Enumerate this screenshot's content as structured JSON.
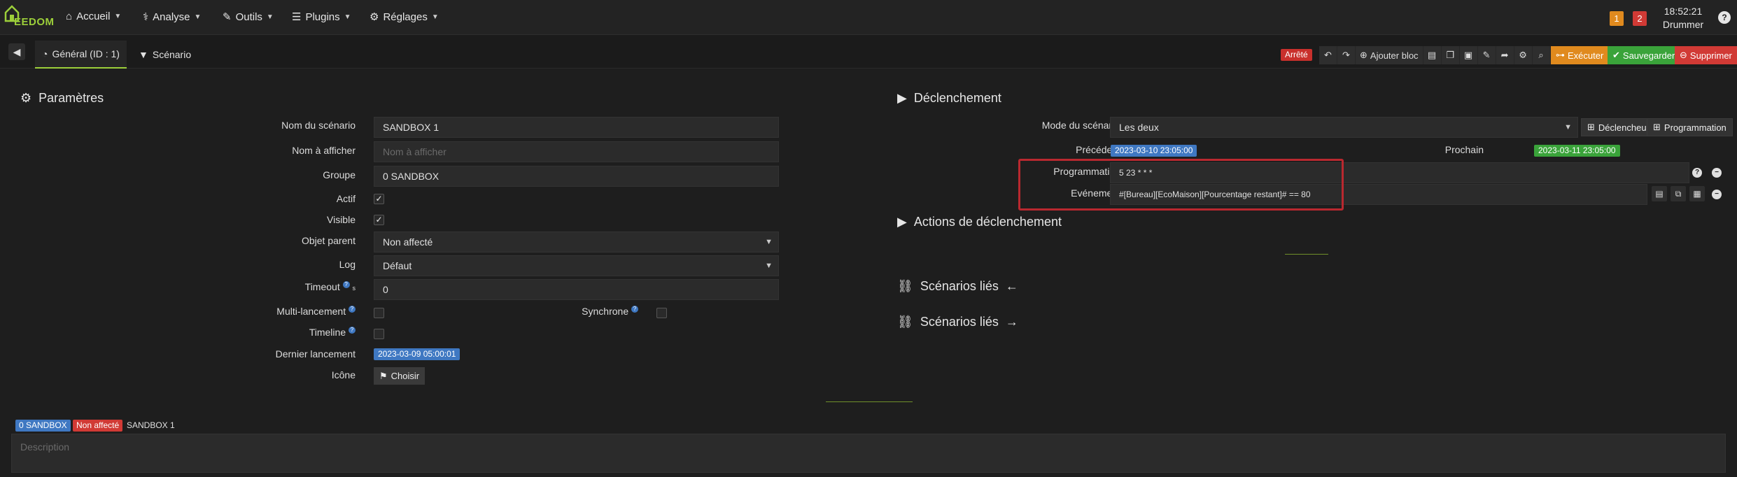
{
  "navbar": {
    "logo_text": "EEDOM",
    "menu": [
      {
        "label": "Accueil",
        "icon": "home-icon"
      },
      {
        "label": "Analyse",
        "icon": "analysis-icon"
      },
      {
        "label": "Outils",
        "icon": "wrench-icon"
      },
      {
        "label": "Plugins",
        "icon": "list-icon"
      },
      {
        "label": "Réglages",
        "icon": "gear-icon"
      }
    ],
    "badge_orange": "1",
    "badge_red": "2",
    "time": "18:52:21",
    "user": "Drummer",
    "help": "?"
  },
  "tabs": {
    "general": "Général (ID : 1)",
    "scenario": "Scénario"
  },
  "toolbar": {
    "status": "Arrêté",
    "add_block": "Ajouter bloc",
    "run": "Exécuter",
    "save": "Sauvegarder",
    "delete": "Supprimer"
  },
  "params": {
    "title": "Paramètres",
    "name_label": "Nom du scénario",
    "name_value": "SANDBOX 1",
    "display_label": "Nom à afficher",
    "display_placeholder": "Nom à afficher",
    "group_label": "Groupe",
    "group_value": "0 SANDBOX",
    "active_label": "Actif",
    "visible_label": "Visible",
    "parent_label": "Objet parent",
    "parent_value": "Non affecté",
    "log_label": "Log",
    "log_value": "Défaut",
    "timeout_label": "Timeout",
    "timeout_suffix": "s",
    "timeout_value": "0",
    "multi_label": "Multi-lancement",
    "sync_label": "Synchrone",
    "timeline_label": "Timeline",
    "last_run_label": "Dernier lancement",
    "last_run_value": "2023-03-09 05:00:01",
    "icon_label": "Icône",
    "icon_button": "Choisir"
  },
  "trigger": {
    "title": "Déclenchement",
    "mode_label": "Mode du scénario",
    "mode_value": "Les deux",
    "btn_trigger": "Déclencheur",
    "btn_schedule": "Programmation",
    "prev_label": "Précédent",
    "prev_value": "2023-03-10 23:05:00",
    "next_label": "Prochain",
    "next_value": "2023-03-11 23:05:00",
    "schedule_label": "Programmation",
    "schedule_value": "5 23 * * *",
    "event_label": "Evénement",
    "event_value": "#[Bureau][EcoMaison][Pourcentage restant]# == 80"
  },
  "sections": {
    "actions_title": "Actions de déclenchement",
    "linked_in": "Scénarios liés",
    "linked_out": "Scénarios liés"
  },
  "footer": {
    "tag_group": "0 SANDBOX",
    "tag_parent": "Non affecté",
    "tag_name": "SANDBOX 1",
    "description_placeholder": "Description"
  },
  "colors": {
    "accent": "#9ccf3a",
    "orange": "#e08a1e",
    "green": "#3aa33a",
    "red": "#d13a35",
    "blue": "#3f78c2"
  }
}
